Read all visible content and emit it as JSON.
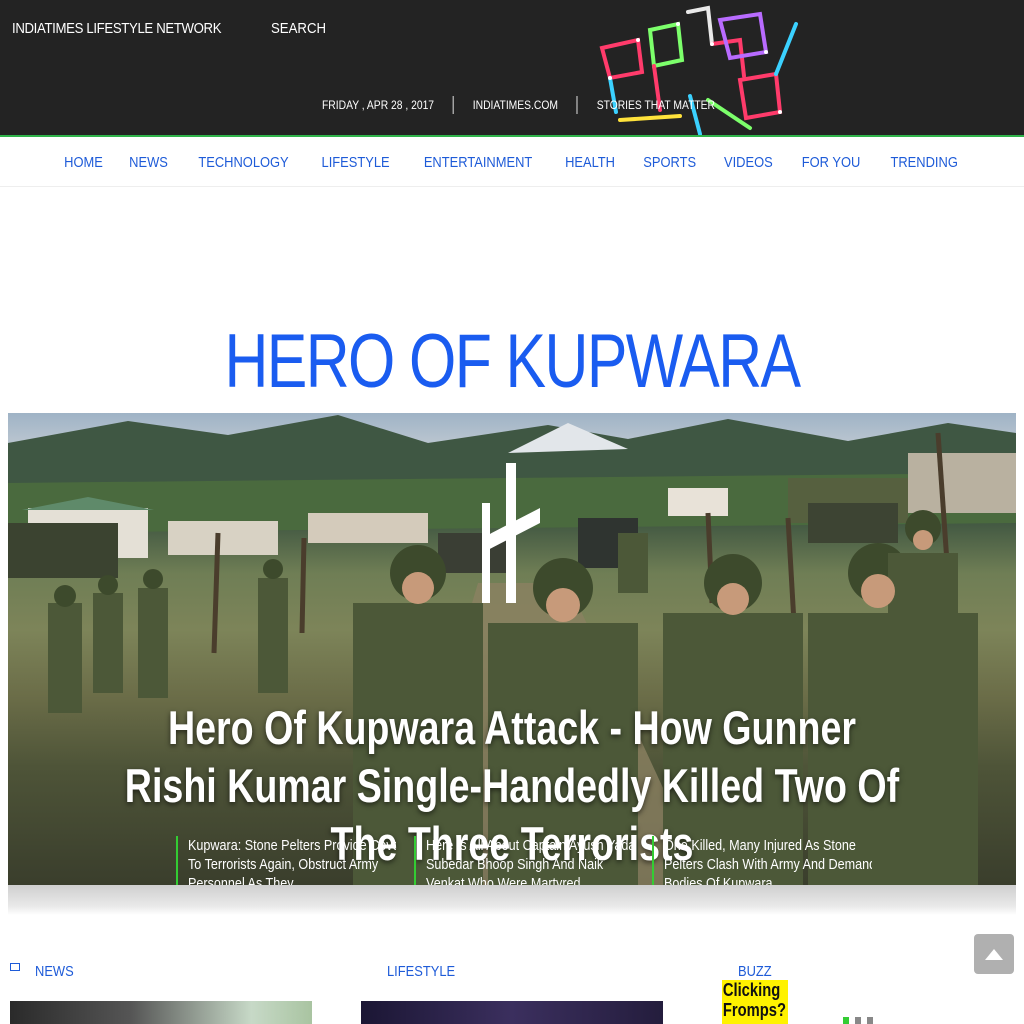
{
  "header": {
    "brand": "INDIATIMES LIFESTYLE NETWORK",
    "search_label": "SEARCH",
    "date": "FRIDAY , APR 28 , 2017",
    "site": "INDIATIMES.COM",
    "tagline": "STORIES THAT MATTER"
  },
  "nav": {
    "items": [
      "HOME",
      "NEWS",
      "TECHNOLOGY",
      "LIFESTYLE",
      "ENTERTAINMENT",
      "HEALTH",
      "SPORTS",
      "VIDEOS",
      "FOR YOU",
      "TRENDING"
    ]
  },
  "hero": {
    "section_title": "HERO OF KUPWARA",
    "headline": "Hero Of Kupwara Attack - How Gunner Rishi Kumar Single-Handedly Killed Two Of The Three Terrorists",
    "related": [
      "Kupwara: Stone Pelters Provide Cover To Terrorists Again, Obstruct Army Personnel As They",
      "Here Is All About Captain Ayush Yadav, Subedar Bhoop Singh And Naik Venkat Who Were Martyred",
      "One Killed, Many Injured As Stone Pelters Clash With Army And Demand Bodies Of Kupwara"
    ]
  },
  "sections": {
    "news": "NEWS",
    "lifestyle": "LIFESTYLE",
    "buzz": "BUZZ",
    "buzz_ad_line1": "Clicking",
    "buzz_ad_line2": "Fromps?"
  },
  "colors": {
    "accent_blue": "#1e5bd8",
    "header_bg": "#232323",
    "accent_green": "#33cc33"
  }
}
